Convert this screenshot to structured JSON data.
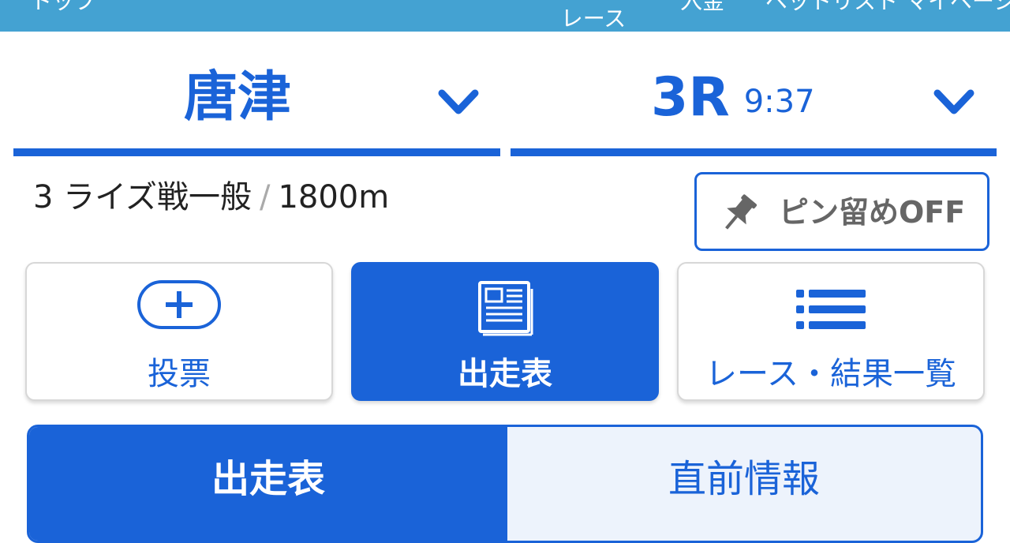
{
  "nav": {
    "top": "トップ",
    "race_line1": "ー・",
    "race_line2": "レース",
    "deposit": "入金",
    "betlist": "ベットリスト",
    "mypage": "マイページ"
  },
  "venue": {
    "name": "唐津",
    "icon": "chevron-down-icon"
  },
  "race": {
    "number": "3R",
    "time": "9:37",
    "icon": "chevron-down-icon"
  },
  "race_info": {
    "class": "3 ライズ戦一般",
    "separator": "/",
    "distance": "1800m"
  },
  "pin": {
    "label": "ピン留めOFF",
    "icon": "pin-icon"
  },
  "tiles": [
    {
      "label": "投票",
      "icon": "plus-icon",
      "active": false
    },
    {
      "label": "出走表",
      "icon": "newspaper-icon",
      "active": true
    },
    {
      "label": "レース・結果一覧",
      "icon": "list-icon",
      "active": false
    }
  ],
  "segment": {
    "tabs": [
      {
        "label": "出走表",
        "active": true
      },
      {
        "label": "直前情報",
        "active": false
      }
    ]
  },
  "colors": {
    "accent": "#1a63d8",
    "nav_bg": "#44a2d2",
    "tab_inactive_bg": "#edf3fc"
  }
}
